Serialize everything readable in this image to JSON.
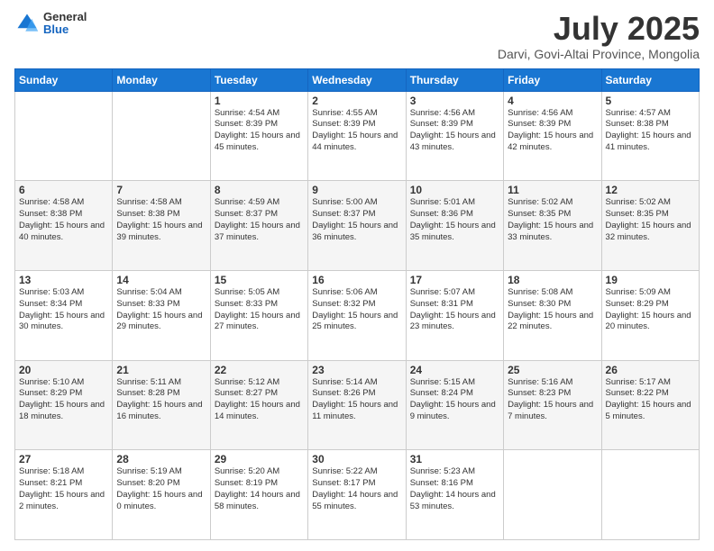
{
  "header": {
    "logo": {
      "general": "General",
      "blue": "Blue"
    },
    "month": "July 2025",
    "location": "Darvi, Govi-Altai Province, Mongolia"
  },
  "days_of_week": [
    "Sunday",
    "Monday",
    "Tuesday",
    "Wednesday",
    "Thursday",
    "Friday",
    "Saturday"
  ],
  "weeks": [
    [
      {
        "day": "",
        "info": ""
      },
      {
        "day": "",
        "info": ""
      },
      {
        "day": "1",
        "info": "Sunrise: 4:54 AM\nSunset: 8:39 PM\nDaylight: 15 hours\nand 45 minutes."
      },
      {
        "day": "2",
        "info": "Sunrise: 4:55 AM\nSunset: 8:39 PM\nDaylight: 15 hours\nand 44 minutes."
      },
      {
        "day": "3",
        "info": "Sunrise: 4:56 AM\nSunset: 8:39 PM\nDaylight: 15 hours\nand 43 minutes."
      },
      {
        "day": "4",
        "info": "Sunrise: 4:56 AM\nSunset: 8:39 PM\nDaylight: 15 hours\nand 42 minutes."
      },
      {
        "day": "5",
        "info": "Sunrise: 4:57 AM\nSunset: 8:38 PM\nDaylight: 15 hours\nand 41 minutes."
      }
    ],
    [
      {
        "day": "6",
        "info": "Sunrise: 4:58 AM\nSunset: 8:38 PM\nDaylight: 15 hours\nand 40 minutes."
      },
      {
        "day": "7",
        "info": "Sunrise: 4:58 AM\nSunset: 8:38 PM\nDaylight: 15 hours\nand 39 minutes."
      },
      {
        "day": "8",
        "info": "Sunrise: 4:59 AM\nSunset: 8:37 PM\nDaylight: 15 hours\nand 37 minutes."
      },
      {
        "day": "9",
        "info": "Sunrise: 5:00 AM\nSunset: 8:37 PM\nDaylight: 15 hours\nand 36 minutes."
      },
      {
        "day": "10",
        "info": "Sunrise: 5:01 AM\nSunset: 8:36 PM\nDaylight: 15 hours\nand 35 minutes."
      },
      {
        "day": "11",
        "info": "Sunrise: 5:02 AM\nSunset: 8:35 PM\nDaylight: 15 hours\nand 33 minutes."
      },
      {
        "day": "12",
        "info": "Sunrise: 5:02 AM\nSunset: 8:35 PM\nDaylight: 15 hours\nand 32 minutes."
      }
    ],
    [
      {
        "day": "13",
        "info": "Sunrise: 5:03 AM\nSunset: 8:34 PM\nDaylight: 15 hours\nand 30 minutes."
      },
      {
        "day": "14",
        "info": "Sunrise: 5:04 AM\nSunset: 8:33 PM\nDaylight: 15 hours\nand 29 minutes."
      },
      {
        "day": "15",
        "info": "Sunrise: 5:05 AM\nSunset: 8:33 PM\nDaylight: 15 hours\nand 27 minutes."
      },
      {
        "day": "16",
        "info": "Sunrise: 5:06 AM\nSunset: 8:32 PM\nDaylight: 15 hours\nand 25 minutes."
      },
      {
        "day": "17",
        "info": "Sunrise: 5:07 AM\nSunset: 8:31 PM\nDaylight: 15 hours\nand 23 minutes."
      },
      {
        "day": "18",
        "info": "Sunrise: 5:08 AM\nSunset: 8:30 PM\nDaylight: 15 hours\nand 22 minutes."
      },
      {
        "day": "19",
        "info": "Sunrise: 5:09 AM\nSunset: 8:29 PM\nDaylight: 15 hours\nand 20 minutes."
      }
    ],
    [
      {
        "day": "20",
        "info": "Sunrise: 5:10 AM\nSunset: 8:29 PM\nDaylight: 15 hours\nand 18 minutes."
      },
      {
        "day": "21",
        "info": "Sunrise: 5:11 AM\nSunset: 8:28 PM\nDaylight: 15 hours\nand 16 minutes."
      },
      {
        "day": "22",
        "info": "Sunrise: 5:12 AM\nSunset: 8:27 PM\nDaylight: 15 hours\nand 14 minutes."
      },
      {
        "day": "23",
        "info": "Sunrise: 5:14 AM\nSunset: 8:26 PM\nDaylight: 15 hours\nand 11 minutes."
      },
      {
        "day": "24",
        "info": "Sunrise: 5:15 AM\nSunset: 8:24 PM\nDaylight: 15 hours\nand 9 minutes."
      },
      {
        "day": "25",
        "info": "Sunrise: 5:16 AM\nSunset: 8:23 PM\nDaylight: 15 hours\nand 7 minutes."
      },
      {
        "day": "26",
        "info": "Sunrise: 5:17 AM\nSunset: 8:22 PM\nDaylight: 15 hours\nand 5 minutes."
      }
    ],
    [
      {
        "day": "27",
        "info": "Sunrise: 5:18 AM\nSunset: 8:21 PM\nDaylight: 15 hours\nand 2 minutes."
      },
      {
        "day": "28",
        "info": "Sunrise: 5:19 AM\nSunset: 8:20 PM\nDaylight: 15 hours\nand 0 minutes."
      },
      {
        "day": "29",
        "info": "Sunrise: 5:20 AM\nSunset: 8:19 PM\nDaylight: 14 hours\nand 58 minutes."
      },
      {
        "day": "30",
        "info": "Sunrise: 5:22 AM\nSunset: 8:17 PM\nDaylight: 14 hours\nand 55 minutes."
      },
      {
        "day": "31",
        "info": "Sunrise: 5:23 AM\nSunset: 8:16 PM\nDaylight: 14 hours\nand 53 minutes."
      },
      {
        "day": "",
        "info": ""
      },
      {
        "day": "",
        "info": ""
      }
    ]
  ]
}
